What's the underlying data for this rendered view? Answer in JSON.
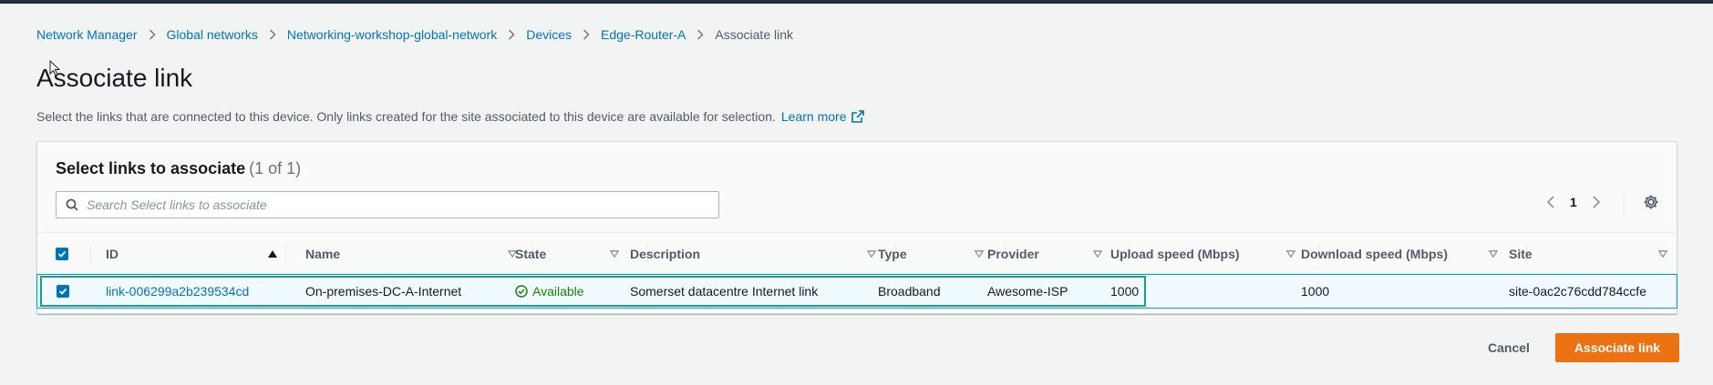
{
  "breadcrumb": {
    "items": [
      "Network Manager",
      "Global networks",
      "Networking-workshop-global-network",
      "Devices",
      "Edge-Router-A"
    ],
    "current": "Associate link"
  },
  "page": {
    "title": "Associate link",
    "description": "Select the links that are connected to this device. Only links created for the site associated to this device are available for selection.",
    "learn_more": "Learn more"
  },
  "panel": {
    "title": "Select links to associate",
    "count": "(1 of 1)",
    "search_placeholder": "Search Select links to associate",
    "search_value": "",
    "page_number": "1"
  },
  "table": {
    "columns": [
      "ID",
      "Name",
      "State",
      "Description",
      "Type",
      "Provider",
      "Upload speed (Mbps)",
      "Download speed (Mbps)",
      "Site"
    ],
    "rows": [
      {
        "selected": true,
        "id": "link-006299a2b239534cd",
        "name": "On-premises-DC-A-Internet",
        "state": "Available",
        "description": "Somerset datacentre Internet link",
        "type": "Broadband",
        "provider": "Awesome-ISP",
        "upload": "1000",
        "download": "1000",
        "site": "site-0ac2c76cdd784ccfe"
      }
    ]
  },
  "actions": {
    "cancel": "Cancel",
    "submit": "Associate link"
  },
  "colors": {
    "link": "#0073bb",
    "primary": "#ec7211",
    "success": "#1d8102",
    "selected_row_bg": "#f1faff",
    "selected_row_border": "#00a1c9"
  }
}
